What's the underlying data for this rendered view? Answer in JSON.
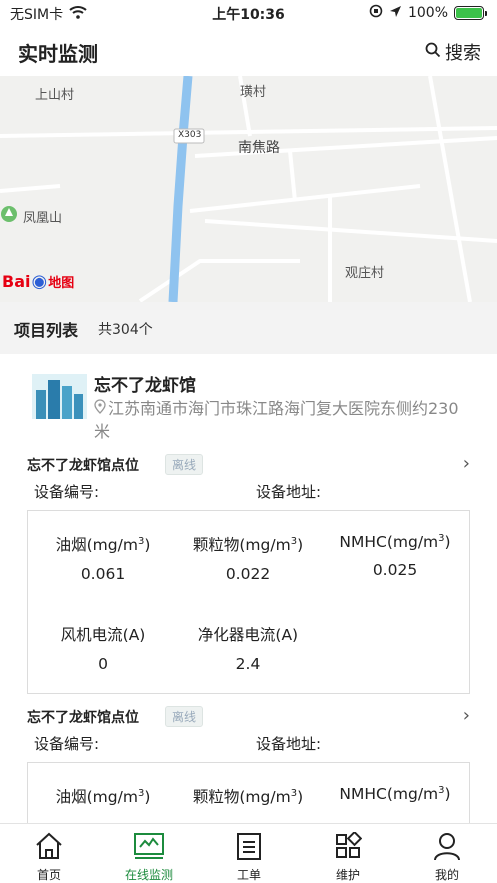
{
  "status_bar": {
    "carrier": "无SIM卡",
    "time": "上午10:36",
    "battery": "100%"
  },
  "header": {
    "title": "实时监测",
    "search_label": "搜索"
  },
  "map": {
    "labels": [
      "上山村",
      "璜村",
      "X303",
      "南焦路",
      "凤凰山",
      "观庄村"
    ],
    "logo_text_1": "Bai",
    "logo_text_2": "地图"
  },
  "project_list": {
    "title": "项目列表",
    "count": "共304个"
  },
  "project": {
    "name": "忘不了龙虾馆",
    "address": "江苏南通市海门市珠江路海门复大医院东侧约230米"
  },
  "points": [
    {
      "name": "忘不了龙虾馆点位",
      "status": "离线",
      "device_no_label": "设备编号:",
      "device_addr_label": "设备地址:",
      "metrics": [
        {
          "label": "油烟(mg/m",
          "sup": "3",
          "close": ")",
          "value": "0.061"
        },
        {
          "label": "颗粒物(mg/m",
          "sup": "3",
          "close": ")",
          "value": "0.022"
        },
        {
          "label": "NMHC(mg/m",
          "sup": "3",
          "close": ")",
          "value": "0.025"
        },
        {
          "label": "风机电流(A)",
          "sup": "",
          "close": "",
          "value": "0"
        },
        {
          "label": "净化器电流(A)",
          "sup": "",
          "close": "",
          "value": "2.4"
        }
      ]
    },
    {
      "name": "忘不了龙虾馆点位",
      "status": "离线",
      "device_no_label": "设备编号:",
      "device_addr_label": "设备地址:",
      "metrics": [
        {
          "label": "油烟(mg/m",
          "sup": "3",
          "close": ")"
        },
        {
          "label": "颗粒物(mg/m",
          "sup": "3",
          "close": ")"
        },
        {
          "label": "NMHC(mg/m",
          "sup": "3",
          "close": ")"
        }
      ]
    }
  ],
  "tabs": [
    {
      "label": "首页",
      "icon": "home-icon"
    },
    {
      "label": "在线监测",
      "icon": "monitor-icon"
    },
    {
      "label": "工单",
      "icon": "clipboard-icon"
    },
    {
      "label": "维护",
      "icon": "grid-icon"
    },
    {
      "label": "我的",
      "icon": "user-icon"
    }
  ],
  "colors": {
    "accent": "#1c8b3d",
    "river": "#8fc3ef"
  }
}
